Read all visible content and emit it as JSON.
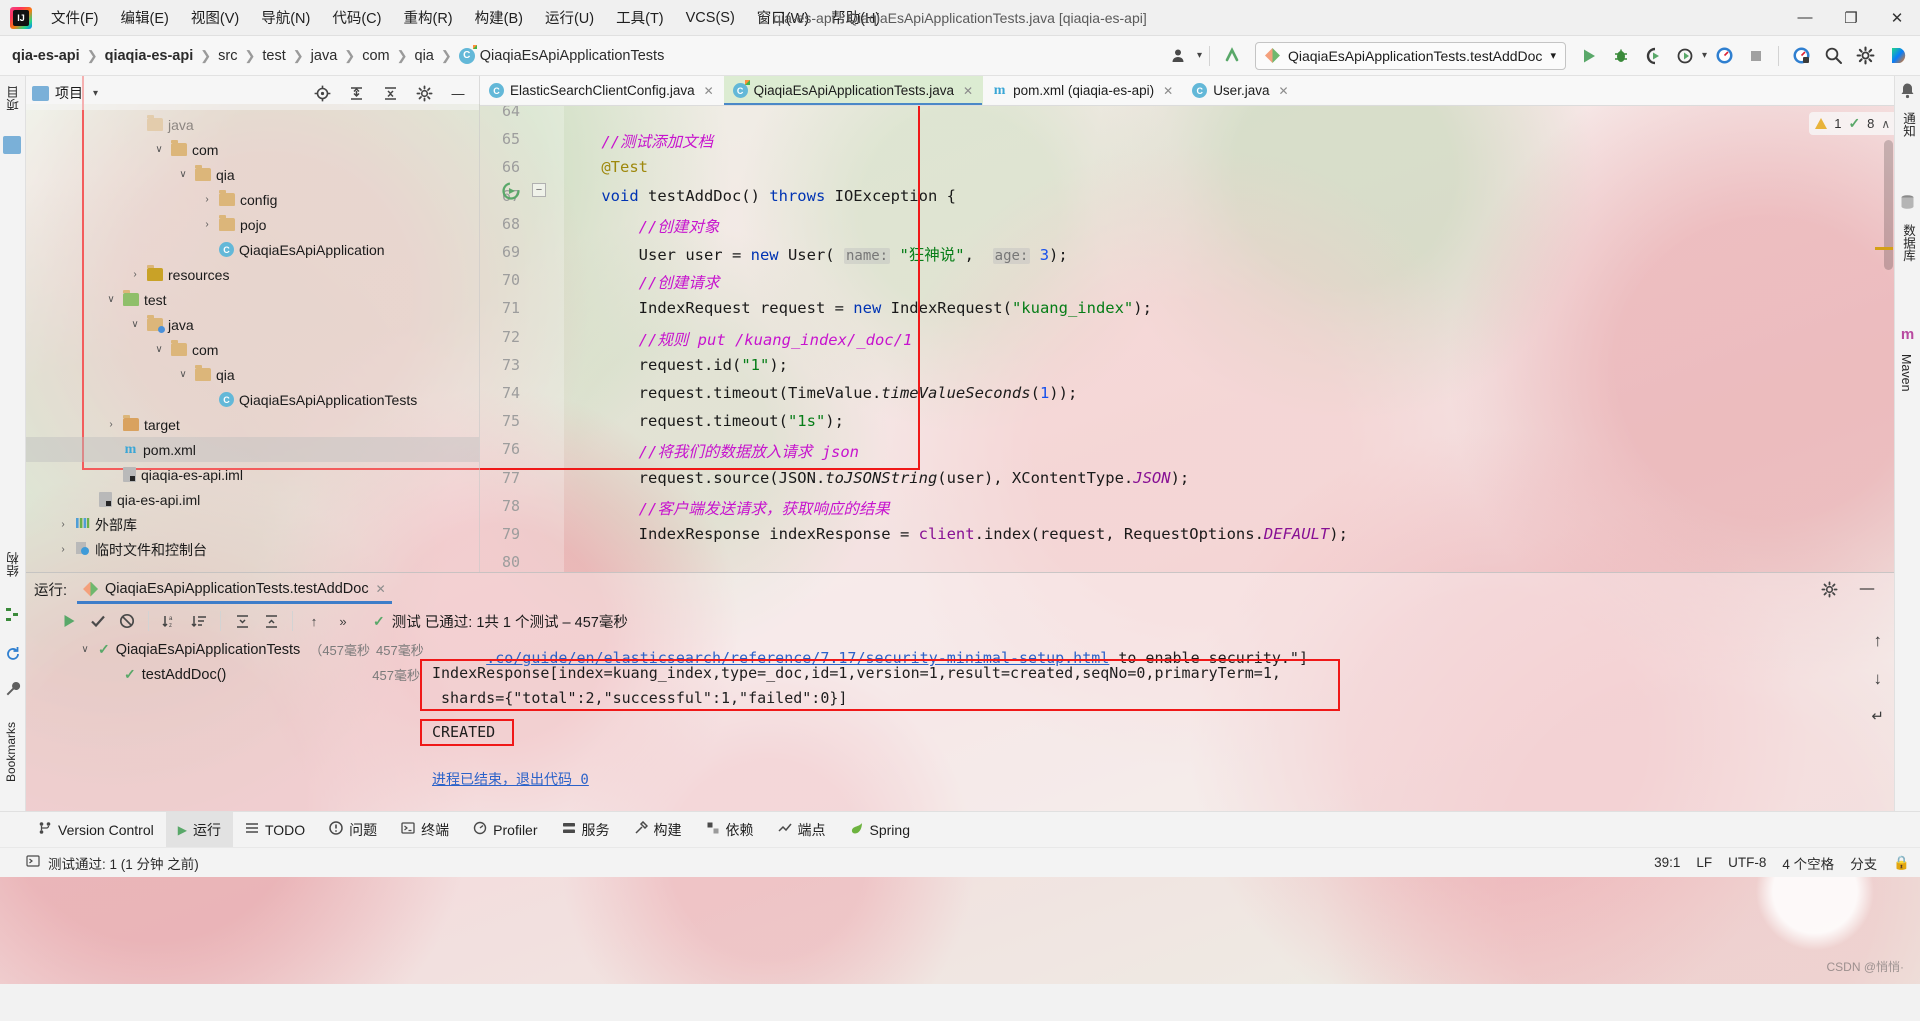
{
  "window": {
    "title": "qia-es-api - QiaqiaEsApiApplicationTests.java [qiaqia-es-api]",
    "minimize": "—",
    "maximize": "❐",
    "close": "✕",
    "logo": "intellij-idea-logo"
  },
  "menu": [
    {
      "label": "文件(F)",
      "name": "menu-file"
    },
    {
      "label": "编辑(E)",
      "name": "menu-edit"
    },
    {
      "label": "视图(V)",
      "name": "menu-view"
    },
    {
      "label": "导航(N)",
      "name": "menu-navigate"
    },
    {
      "label": "代码(C)",
      "name": "menu-code"
    },
    {
      "label": "重构(R)",
      "name": "menu-refactor"
    },
    {
      "label": "构建(B)",
      "name": "menu-build"
    },
    {
      "label": "运行(U)",
      "name": "menu-run"
    },
    {
      "label": "工具(T)",
      "name": "menu-tools"
    },
    {
      "label": "VCS(S)",
      "name": "menu-vcs"
    },
    {
      "label": "窗口(W)",
      "name": "menu-window"
    },
    {
      "label": "帮助(H)",
      "name": "menu-help"
    }
  ],
  "breadcrumb": [
    {
      "label": "qia-es-api",
      "bold": true
    },
    {
      "label": "qiaqia-es-api",
      "bold": true
    },
    {
      "label": "src",
      "bold": false
    },
    {
      "label": "test",
      "bold": false
    },
    {
      "label": "java",
      "bold": false
    },
    {
      "label": "com",
      "bold": false
    },
    {
      "label": "qia",
      "bold": false
    },
    {
      "label": "QiaqiaEsApiApplicationTests",
      "bold": false
    }
  ],
  "toolbar": {
    "run_config": "QiaqiaEsApiApplicationTests.testAddDoc",
    "run_config_chevron": "▾",
    "run": "▶",
    "debug": "debug-icon",
    "run_coverage": "coverage-icon",
    "profile": "profiler-icon",
    "profile_chevron": "▾",
    "run_with": "run-dashboard-icon",
    "stop": "■",
    "updates": "update-icon",
    "search": "⌕",
    "settings": "⚙",
    "ide_assistant": "ide-assistant-icon",
    "avatar": "user-avatar-icon",
    "avatar_chevron": "▾",
    "vcs_update": "vcs-update-icon"
  },
  "editor_tabs": [
    {
      "label": "ElasticSearchClientConfig.java",
      "icon": "java-class-icon",
      "active": false,
      "close": "✕"
    },
    {
      "label": "QiaqiaEsApiApplicationTests.java",
      "icon": "java-test-class-icon",
      "active": true,
      "close": "✕"
    },
    {
      "label": "pom.xml (qiaqia-es-api)",
      "icon": "maven-icon",
      "active": false,
      "close": "✕"
    },
    {
      "label": "User.java",
      "icon": "java-class-icon",
      "active": false,
      "close": "✕"
    }
  ],
  "left_strip": [
    {
      "label": "项目",
      "name": "tool-project"
    },
    {
      "label": "结构",
      "name": "tool-structure"
    },
    {
      "label": "Bookmarks",
      "name": "tool-bookmarks"
    }
  ],
  "right_strip": [
    {
      "label": "通知",
      "name": "tool-notifications"
    },
    {
      "label": "数据库",
      "name": "tool-database"
    },
    {
      "label": "Maven",
      "name": "tool-maven"
    }
  ],
  "project_panel": {
    "title": "项目",
    "title_chevron": "▾",
    "actions": {
      "locate": "target-icon",
      "expand_all": "expand-all-icon",
      "collapse_all": "collapse-all-icon",
      "settings": "gear-icon",
      "hide": "—"
    },
    "tree": [
      {
        "label": "java",
        "indent": 4,
        "arrow": "",
        "icon": "folder",
        "sel": false,
        "faded": true
      },
      {
        "label": "com",
        "indent": 5,
        "arrow": "∨",
        "icon": "folder",
        "sel": false
      },
      {
        "label": "qia",
        "indent": 6,
        "arrow": "∨",
        "icon": "folder",
        "sel": false
      },
      {
        "label": "config",
        "indent": 7,
        "arrow": "›",
        "icon": "folder",
        "sel": false
      },
      {
        "label": "pojo",
        "indent": 7,
        "arrow": "›",
        "icon": "folder",
        "sel": false
      },
      {
        "label": "QiaqiaEsApiApplication",
        "indent": 7,
        "arrow": "",
        "icon": "java",
        "sel": false
      },
      {
        "label": "resources",
        "indent": 4,
        "arrow": "›",
        "icon": "folder-res",
        "sel": false
      },
      {
        "label": "test",
        "indent": 3,
        "arrow": "∨",
        "icon": "folder-test",
        "sel": false
      },
      {
        "label": "java",
        "indent": 4,
        "arrow": "∨",
        "icon": "folder-src",
        "sel": false
      },
      {
        "label": "com",
        "indent": 5,
        "arrow": "∨",
        "icon": "folder",
        "sel": false
      },
      {
        "label": "qia",
        "indent": 6,
        "arrow": "∨",
        "icon": "folder",
        "sel": false
      },
      {
        "label": "QiaqiaEsApiApplicationTests",
        "indent": 7,
        "arrow": "",
        "icon": "java",
        "sel": false
      },
      {
        "label": "target",
        "indent": 3,
        "arrow": "›",
        "icon": "folder-target",
        "sel": false
      },
      {
        "label": "pom.xml",
        "indent": 3,
        "arrow": "",
        "icon": "maven",
        "sel": true
      },
      {
        "label": "qiaqia-es-api.iml",
        "indent": 3,
        "arrow": "",
        "icon": "file",
        "sel": false
      },
      {
        "label": "qia-es-api.iml",
        "indent": 2,
        "arrow": "",
        "icon": "file",
        "sel": false
      },
      {
        "label": "外部库",
        "indent": 1,
        "arrow": "›",
        "icon": "library",
        "sel": false
      },
      {
        "label": "临时文件和控制台",
        "indent": 1,
        "arrow": "›",
        "icon": "scratch",
        "sel": false
      }
    ]
  },
  "editor": {
    "line_numbers": [
      "64",
      "65",
      "66",
      "67",
      "68",
      "69",
      "70",
      "71",
      "72",
      "73",
      "74",
      "75",
      "76",
      "77",
      "78",
      "79",
      "80"
    ],
    "first_line_number": 64,
    "gutter_icons": {
      "line67_run": "run-test-gutter-icon",
      "line67_fold": "fold-minus-icon"
    },
    "inspections": {
      "warnings_count": "1",
      "ok_count": "8",
      "up": "∧",
      "down": "∨"
    },
    "code_lines": [
      {
        "n": 64,
        "segments": []
      },
      {
        "n": 65,
        "segments": [
          {
            "t": "    ",
            "c": ""
          },
          {
            "t": "//测试添加文档",
            "c": "cm"
          }
        ]
      },
      {
        "n": 66,
        "segments": [
          {
            "t": "    ",
            "c": ""
          },
          {
            "t": "@Test",
            "c": "anno"
          }
        ]
      },
      {
        "n": 67,
        "segments": [
          {
            "t": "    ",
            "c": ""
          },
          {
            "t": "void",
            "c": "kw"
          },
          {
            "t": " testAddDoc() ",
            "c": ""
          },
          {
            "t": "throws",
            "c": "kw"
          },
          {
            "t": " IOException {",
            "c": ""
          }
        ]
      },
      {
        "n": 68,
        "segments": [
          {
            "t": "        ",
            "c": ""
          },
          {
            "t": "//创建对象",
            "c": "cm"
          }
        ]
      },
      {
        "n": 69,
        "segments": [
          {
            "t": "        User user = ",
            "c": ""
          },
          {
            "t": "new",
            "c": "kw"
          },
          {
            "t": " User( ",
            "c": ""
          },
          {
            "t": "name:",
            "c": "hint"
          },
          {
            "t": " ",
            "c": ""
          },
          {
            "t": "\"狂神说\"",
            "c": "st"
          },
          {
            "t": ",  ",
            "c": ""
          },
          {
            "t": "age:",
            "c": "hint"
          },
          {
            "t": " ",
            "c": ""
          },
          {
            "t": "3",
            "c": "num"
          },
          {
            "t": ");",
            "c": ""
          }
        ]
      },
      {
        "n": 70,
        "segments": [
          {
            "t": "        ",
            "c": ""
          },
          {
            "t": "//创建请求",
            "c": "cm"
          }
        ]
      },
      {
        "n": 71,
        "segments": [
          {
            "t": "        IndexRequest request = ",
            "c": ""
          },
          {
            "t": "new",
            "c": "kw"
          },
          {
            "t": " IndexRequest(",
            "c": ""
          },
          {
            "t": "\"kuang_index\"",
            "c": "st"
          },
          {
            "t": ");",
            "c": ""
          }
        ]
      },
      {
        "n": 72,
        "segments": [
          {
            "t": "        ",
            "c": ""
          },
          {
            "t": "//规则 put /kuang_index/_doc/1",
            "c": "cm"
          }
        ]
      },
      {
        "n": 73,
        "segments": [
          {
            "t": "        request.id(",
            "c": ""
          },
          {
            "t": "\"1\"",
            "c": "st"
          },
          {
            "t": ");",
            "c": ""
          }
        ]
      },
      {
        "n": 74,
        "segments": [
          {
            "t": "        request.timeout(TimeValue.",
            "c": ""
          },
          {
            "t": "timeValueSeconds",
            "c": "ital"
          },
          {
            "t": "(",
            "c": ""
          },
          {
            "t": "1",
            "c": "num"
          },
          {
            "t": "));",
            "c": ""
          }
        ]
      },
      {
        "n": 75,
        "segments": [
          {
            "t": "        request.timeout(",
            "c": ""
          },
          {
            "t": "\"1s\"",
            "c": "st"
          },
          {
            "t": ");",
            "c": ""
          }
        ]
      },
      {
        "n": 76,
        "segments": [
          {
            "t": "        ",
            "c": ""
          },
          {
            "t": "//将我们的数据放入请求 json",
            "c": "cm"
          }
        ]
      },
      {
        "n": 77,
        "segments": [
          {
            "t": "        request.source(JSON.",
            "c": ""
          },
          {
            "t": "toJSONString",
            "c": "ital"
          },
          {
            "t": "(user), XContentType.",
            "c": ""
          },
          {
            "t": "JSON",
            "c": "fld ital"
          },
          {
            "t": ");",
            "c": ""
          }
        ]
      },
      {
        "n": 78,
        "segments": [
          {
            "t": "        ",
            "c": ""
          },
          {
            "t": "//客户端发送请求，获取响应的结果",
            "c": "cm"
          }
        ]
      },
      {
        "n": 79,
        "segments": [
          {
            "t": "        IndexResponse indexResponse = ",
            "c": ""
          },
          {
            "t": "client",
            "c": "fld"
          },
          {
            "t": ".index(request, RequestOptions.",
            "c": ""
          },
          {
            "t": "DEFAULT",
            "c": "fld ital"
          },
          {
            "t": ");",
            "c": ""
          }
        ]
      },
      {
        "n": 80,
        "segments": []
      }
    ]
  },
  "run_window": {
    "label": "运行:",
    "tab_title": "QiaqiaEsApiApplicationTests.testAddDoc",
    "tab_close": "✕",
    "settings_icon": "gear-icon",
    "hide_icon": "—",
    "toolbar": {
      "rerun": "▶",
      "rerun_failed": "✓",
      "toggle_ignored": "⊘",
      "sort_alpha": "sort-alphabetically-icon",
      "sort_duration": "sort-by-duration-icon",
      "expand_all": "expand-all-icon",
      "collapse_all": "collapse-all-icon",
      "prev_fail": "↑",
      "next_fail": "»"
    },
    "status_text": "测试 已通过: 1共 1 个测试 – 457毫秒",
    "status_icon": "check-green-icon",
    "tests": [
      {
        "label": "QiaqiaEsApiApplicationTests",
        "suffix": "（457毫秒",
        "duration": "457毫秒",
        "arrow": "∨",
        "icon": "check-green-icon",
        "indent": 0
      },
      {
        "label": "testAddDoc()",
        "suffix": "",
        "duration": "457毫秒",
        "arrow": "",
        "icon": "check-green-icon",
        "indent": 1
      }
    ],
    "console": {
      "line1_link": ".co/guide/en/elasticsearch/reference/7.17/security-minimal-setup.html",
      "line1_rest": " to enable security.\"]",
      "line2": "IndexResponse[index=kuang_index,type=_doc,id=1,version=1,result=created,seqNo=0,primaryTerm=1,",
      "line3": " shards={\"total\":2,\"successful\":1,\"failed\":0}]",
      "line4": "CREATED",
      "line5": "进程已结束，退出代码 0",
      "scroll_up": "↑",
      "scroll_down": "↓",
      "wrap": "↵"
    }
  },
  "bottom_bar": [
    {
      "label": "Version Control",
      "icon": "branch-icon",
      "name": "bottom-version-control",
      "active": false
    },
    {
      "label": "运行",
      "icon": "▶",
      "name": "bottom-run",
      "active": true
    },
    {
      "label": "TODO",
      "icon": "list-icon",
      "name": "bottom-todo",
      "active": false
    },
    {
      "label": "问题",
      "icon": "⚠",
      "name": "bottom-problems",
      "active": false
    },
    {
      "label": "终端",
      "icon": "terminal-icon",
      "name": "bottom-terminal",
      "active": false
    },
    {
      "label": "Profiler",
      "icon": "profiler-icon",
      "name": "bottom-profiler",
      "active": false
    },
    {
      "label": "服务",
      "icon": "services-icon",
      "name": "bottom-services",
      "active": false
    },
    {
      "label": "构建",
      "icon": "hammer-icon",
      "name": "bottom-build",
      "active": false
    },
    {
      "label": "依赖",
      "icon": "dependencies-icon",
      "name": "bottom-dependencies",
      "active": false
    },
    {
      "label": "端点",
      "icon": "endpoints-icon",
      "name": "bottom-endpoints",
      "active": false
    },
    {
      "label": "Spring",
      "icon": "spring-leaf-icon",
      "name": "bottom-spring",
      "active": false
    }
  ],
  "status_bar": {
    "message": "测试通过: 1 (1 分钟 之前)",
    "message_icon": "terminal-icon",
    "caret": "39:1",
    "line_sep": "LF",
    "encoding": "UTF-8",
    "indent": "4 个空格",
    "branch": "分支",
    "lock": "🔒"
  },
  "watermark": "CSDN @悄悄·",
  "colors": {
    "accent_blue": "#3d7dc9",
    "tab_active": "#dcecd2",
    "annotation_red": "#f01818",
    "string_green": "#067d17",
    "keyword_blue": "#0033b3",
    "comment_purple": "#c714ce",
    "run_green": "#59a869"
  }
}
